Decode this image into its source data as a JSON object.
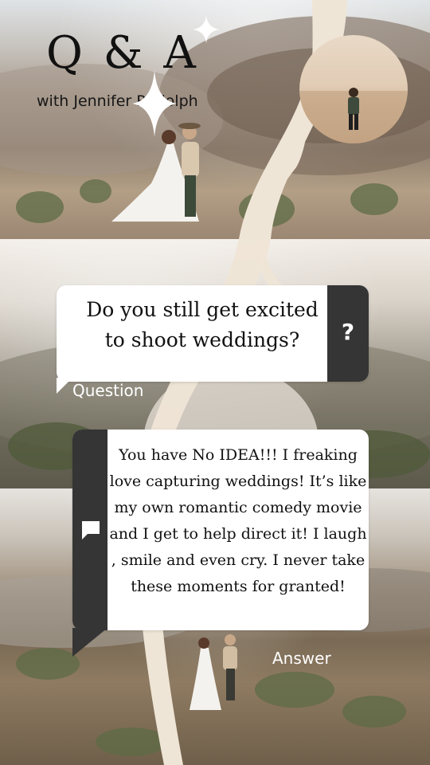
{
  "header": {
    "title": "Q & A",
    "subtitle": "with Jennifer Rudolph"
  },
  "question": {
    "text": "Do you still get excited to shoot weddings?",
    "icon_glyph": "?",
    "label": "Question"
  },
  "answer": {
    "text": "You have No IDEA!!! I freaking love capturing weddings! It’s like my own romantic comedy movie and I get to help direct it! I laugh , smile and even cry. I never take these moments for granted!",
    "icon": "speech-bubble-icon",
    "label": "Answer"
  },
  "colors": {
    "card": "#ffffff",
    "accent_dark": "#353535",
    "swoosh": "#efe5d6"
  }
}
